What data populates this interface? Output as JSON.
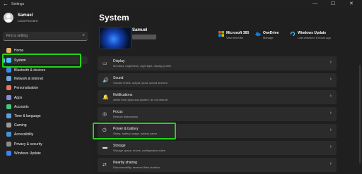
{
  "window": {
    "title": "Settings",
    "back": "←",
    "minimize": "—",
    "maximize": "☐",
    "close": "✕"
  },
  "user": {
    "name": "Samuel",
    "account": "Local Account"
  },
  "search": {
    "placeholder": "Find a setting"
  },
  "nav": [
    {
      "label": "Home",
      "color": "#e8b26a"
    },
    {
      "label": "System",
      "color": "#4cc2ff"
    },
    {
      "label": "Bluetooth & devices",
      "color": "#3a8ee6"
    },
    {
      "label": "Network & internet",
      "color": "#6fa8dc"
    },
    {
      "label": "Personalisation",
      "color": "#e07a5f"
    },
    {
      "label": "Apps",
      "color": "#8a8ad8"
    },
    {
      "label": "Accounts",
      "color": "#47c47a"
    },
    {
      "label": "Time & language",
      "color": "#5aa0e0"
    },
    {
      "label": "Gaming",
      "color": "#9a9a9a"
    },
    {
      "label": "Accessibility",
      "color": "#4a90d9"
    },
    {
      "label": "Privacy & security",
      "color": "#8c8c8c"
    },
    {
      "label": "Windows Update",
      "color": "#3b82f6"
    }
  ],
  "main": {
    "title": "System",
    "pc_name": "Samuel",
    "quick": [
      {
        "title": "Microsoft 365",
        "sub": "View benefits",
        "icon": "microsoft-365-icon"
      },
      {
        "title": "OneDrive",
        "sub": "Manage",
        "icon": "onedrive-icon"
      },
      {
        "title": "Windows Update",
        "sub": "Last checked: 8 hours ago",
        "icon": "windows-update-icon"
      }
    ],
    "rows": [
      {
        "title": "Display",
        "sub": "Monitors, brightness, night light, display profile",
        "icon": "▭"
      },
      {
        "title": "Sound",
        "sub": "Volume levels, output, input, sound devices",
        "icon": "🔊"
      },
      {
        "title": "Notifications",
        "sub": "Alerts from apps and system, do not disturb",
        "icon": "🔔"
      },
      {
        "title": "Focus",
        "sub": "Reduce distractions",
        "icon": "◎"
      },
      {
        "title": "Power & battery",
        "sub": "Sleep, battery usage, battery saver",
        "icon": "⏻"
      },
      {
        "title": "Storage",
        "sub": "Storage space, drives, configuration rules",
        "icon": "▬"
      },
      {
        "title": "Nearby sharing",
        "sub": "Discoverability, received files location",
        "icon": "⇄"
      }
    ],
    "chevron": "›"
  }
}
